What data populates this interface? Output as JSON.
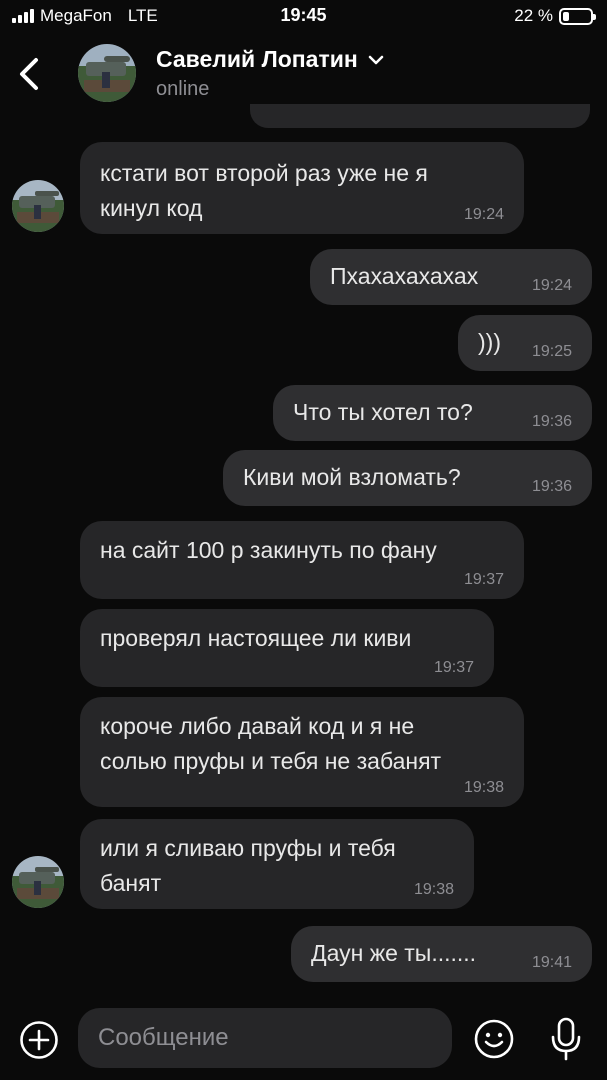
{
  "status": {
    "carrier": "MegaFon",
    "network": "LTE",
    "time": "19:45",
    "battery_text": "22 %",
    "battery_level": 0.22
  },
  "header": {
    "contact_name": "Савелий Лопатин",
    "contact_status": "online",
    "back_icon": "chevron-left-icon",
    "dropdown_icon": "chevron-down-icon"
  },
  "messages": [
    {
      "dir": "in",
      "text": "кстати вот второй раз уже не я\nкинул код",
      "time": "19:24"
    },
    {
      "dir": "out",
      "text": "Пхахахахахах",
      "time": "19:24"
    },
    {
      "dir": "out",
      "text": ")))",
      "time": "19:25"
    },
    {
      "dir": "out",
      "text": "Что ты хотел то?",
      "time": "19:36"
    },
    {
      "dir": "out",
      "text": "Киви мой взломать?",
      "time": "19:36"
    },
    {
      "dir": "in",
      "text": "на сайт 100 р закинуть по фану",
      "time": "19:37"
    },
    {
      "dir": "in",
      "text": "проверял настоящее ли киви",
      "time": "19:37"
    },
    {
      "dir": "in",
      "text": "короче либо давай код и я не\nсолью пруфы и тебя не забанят",
      "time": "19:38"
    },
    {
      "dir": "in",
      "text": "или я сливаю пруфы и тебя\nбанят",
      "time": "19:38"
    },
    {
      "dir": "out",
      "text": "Даун же ты.......",
      "time": "19:41"
    }
  ],
  "composer": {
    "placeholder": "Сообщение",
    "attach_icon": "plus-circle-icon",
    "emoji_icon": "emoji-icon",
    "mic_icon": "microphone-icon"
  },
  "colors": {
    "background": "#0a0a0a",
    "incoming_bubble": "#262628",
    "outgoing_bubble": "#2f2f31",
    "timestamp": "#8e8e93",
    "text": "#e8e8e8"
  }
}
